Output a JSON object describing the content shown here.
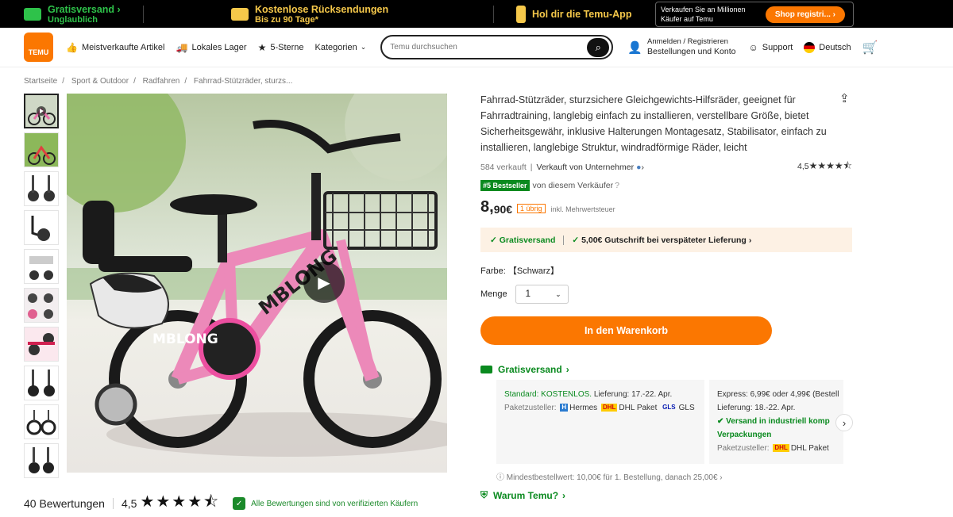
{
  "topbar": {
    "free_shipping_title": "Gratisversand",
    "free_shipping_sub": "Unglaublich",
    "returns_title": "Kostenlose Rücksendungen",
    "returns_sub": "Bis zu 90 Tage*",
    "app_label": "Hol dir die Temu-App",
    "promo_text_1": "Verkaufen Sie an Millionen",
    "promo_text_2": "Käufer auf Temu",
    "promo_button": "Shop registri..."
  },
  "header": {
    "logo_text": "TEMU",
    "nav": [
      "Meistverkaufte Artikel",
      "Lokales Lager",
      "5-Sterne",
      "Kategorien"
    ],
    "search_placeholder": "Temu durchsuchen",
    "account_line1": "Anmelden / Registrieren",
    "account_line2": "Bestellungen und Konto",
    "support": "Support",
    "language": "Deutsch"
  },
  "breadcrumb": [
    "Startseite",
    "Sport & Outdoor",
    "Radfahren",
    "Fahrrad-Stützräder, sturzs..."
  ],
  "product": {
    "title": "Fahrrad-Stützräder, sturzsichere Gleichgewichts-Hilfsräder, geeignet für Fahrradtraining, langlebig einfach zu installieren, verstellbare Größe, bietet Sicherheitsgewähr, inklusive Halterungen Montagesatz, Stabilisator, einfach zu installieren, langlebige Struktur, windradförmige Räder, leicht",
    "sold": "584 verkauft",
    "seller": "Verkauft von Unternehmer",
    "rating": "4,5",
    "rating_value": 4.5,
    "bestseller_badge": "#5 Bestseller",
    "bestseller_text": "von diesem Verkäufer",
    "price_main": "8,",
    "price_cents": "90€",
    "stock_badge": "1 übrig",
    "vat_text": "inkl. Mehrwertsteuer",
    "shipbar_free": "Gratisversand",
    "shipbar_credit": "5,00€ Gutschrift bei verspäteter Lieferung",
    "color_label": "Farbe:",
    "color_value": "【Schwarz】",
    "qty_label": "Menge",
    "qty_value": "1",
    "cart_button": "In den Warenkorb"
  },
  "shipping": {
    "heading": "Gratisversand",
    "standard_label": "Standard: KOSTENLOS.",
    "standard_delivery": "Lieferung: 17.-22. Apr.",
    "carriers_label": "Paketzusteller:",
    "carriers": [
      "Hermes",
      "DHL Paket",
      "GLS"
    ],
    "express_line": "Express: 6,99€ oder 4,99€ (Bestell",
    "express_delivery": "Lieferung: 18.-22. Apr.",
    "express_industrial": "Versand in industriell komp",
    "express_packaging": "Verpackungen",
    "express_carrier": "DHL Paket",
    "min_order": "Mindestbestellwert: 10,00€ für 1. Bestellung, danach 25,00€"
  },
  "why": {
    "heading": "Warum Temu?"
  },
  "reviews": {
    "count_label": "40 Bewertungen",
    "rating": "4,5",
    "verified_text": "Alle Bewertungen sind von verifizierten Käufern"
  },
  "colors": {
    "accent": "#fb7701",
    "green": "#0a8a1f"
  }
}
